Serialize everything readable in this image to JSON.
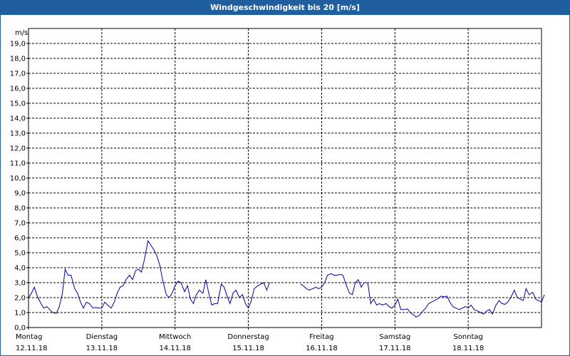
{
  "chart_data": {
    "type": "line",
    "title": "Windgeschwindigkeit bis 20 [m/s]",
    "ylabel": "m/s",
    "ylim": [
      0,
      20
    ],
    "yticks": [
      "0,0",
      "1,0",
      "2,0",
      "3,0",
      "4,0",
      "5,0",
      "6,0",
      "7,0",
      "8,0",
      "9,0",
      "10,0",
      "11,0",
      "12,0",
      "13,0",
      "14,0",
      "15,0",
      "16,0",
      "17,0",
      "18,0",
      "19,0"
    ],
    "xlim": [
      0,
      7
    ],
    "x_categories": [
      {
        "day": "Montag",
        "date": "12.11.18"
      },
      {
        "day": "Dienstag",
        "date": "13.11.18"
      },
      {
        "day": "Mittwoch",
        "date": "14.11.18"
      },
      {
        "day": "Donnerstag",
        "date": "15.11.18"
      },
      {
        "day": "Freitag",
        "date": "16.11.18"
      },
      {
        "day": "Samstag",
        "date": "17.11.18"
      },
      {
        "day": "Sonntag",
        "date": "18.11.18"
      }
    ],
    "grid": true,
    "series_color": "#0000a0",
    "series": [
      {
        "segments": [
          [
            [
              0.0,
              2.0
            ],
            [
              0.04,
              2.3
            ],
            [
              0.08,
              2.7
            ],
            [
              0.12,
              2.1
            ],
            [
              0.17,
              1.6
            ],
            [
              0.21,
              1.3
            ],
            [
              0.25,
              1.4
            ],
            [
              0.29,
              1.2
            ],
            [
              0.33,
              1.0
            ],
            [
              0.38,
              0.95
            ],
            [
              0.42,
              1.4
            ],
            [
              0.46,
              2.2
            ],
            [
              0.5,
              3.9
            ],
            [
              0.54,
              3.5
            ],
            [
              0.58,
              3.5
            ],
            [
              0.63,
              2.6
            ],
            [
              0.67,
              2.3
            ],
            [
              0.71,
              1.7
            ],
            [
              0.75,
              1.3
            ],
            [
              0.79,
              1.7
            ],
            [
              0.83,
              1.6
            ],
            [
              0.88,
              1.3
            ],
            [
              0.92,
              1.35
            ],
            [
              0.96,
              1.3
            ],
            [
              1.0,
              1.3
            ],
            [
              1.04,
              1.7
            ],
            [
              1.08,
              1.5
            ],
            [
              1.13,
              1.3
            ],
            [
              1.17,
              1.7
            ],
            [
              1.21,
              2.3
            ],
            [
              1.25,
              2.7
            ],
            [
              1.29,
              2.8
            ],
            [
              1.33,
              3.2
            ],
            [
              1.38,
              3.5
            ],
            [
              1.42,
              3.2
            ],
            [
              1.46,
              3.8
            ],
            [
              1.5,
              3.9
            ],
            [
              1.54,
              3.7
            ],
            [
              1.58,
              4.5
            ],
            [
              1.63,
              5.8
            ],
            [
              1.67,
              5.5
            ],
            [
              1.71,
              5.2
            ],
            [
              1.75,
              4.8
            ],
            [
              1.79,
              4.2
            ],
            [
              1.83,
              3.2
            ],
            [
              1.88,
              2.2
            ],
            [
              1.92,
              2.0
            ],
            [
              1.96,
              2.3
            ],
            [
              2.0,
              2.8
            ],
            [
              2.04,
              3.1
            ],
            [
              2.08,
              3.0
            ],
            [
              2.13,
              2.4
            ],
            [
              2.17,
              2.8
            ],
            [
              2.21,
              1.9
            ],
            [
              2.25,
              1.6
            ],
            [
              2.29,
              2.2
            ],
            [
              2.33,
              2.5
            ],
            [
              2.38,
              2.3
            ],
            [
              2.42,
              3.2
            ],
            [
              2.46,
              2.3
            ],
            [
              2.5,
              1.5
            ],
            [
              2.54,
              1.6
            ],
            [
              2.58,
              1.6
            ],
            [
              2.63,
              2.9
            ],
            [
              2.67,
              2.7
            ],
            [
              2.71,
              2.1
            ],
            [
              2.75,
              1.6
            ],
            [
              2.79,
              2.3
            ],
            [
              2.83,
              2.5
            ],
            [
              2.88,
              2.0
            ],
            [
              2.92,
              2.2
            ],
            [
              2.96,
              1.6
            ],
            [
              3.0,
              1.3
            ],
            [
              3.04,
              1.8
            ],
            [
              3.08,
              2.6
            ],
            [
              3.13,
              2.8
            ],
            [
              3.17,
              2.9
            ],
            [
              3.21,
              3.0
            ],
            [
              3.25,
              2.5
            ],
            [
              3.29,
              3.0
            ]
          ],
          [
            [
              3.71,
              2.9
            ],
            [
              3.75,
              2.8
            ],
            [
              3.79,
              2.6
            ],
            [
              3.83,
              2.5
            ],
            [
              3.88,
              2.6
            ],
            [
              3.92,
              2.7
            ],
            [
              3.96,
              2.6
            ],
            [
              4.0,
              2.7
            ],
            [
              4.04,
              3.0
            ],
            [
              4.08,
              3.5
            ],
            [
              4.13,
              3.6
            ],
            [
              4.17,
              3.5
            ],
            [
              4.21,
              3.5
            ],
            [
              4.25,
              3.55
            ],
            [
              4.29,
              3.5
            ],
            [
              4.33,
              2.9
            ],
            [
              4.38,
              2.3
            ],
            [
              4.42,
              2.2
            ],
            [
              4.46,
              3.0
            ],
            [
              4.5,
              3.2
            ],
            [
              4.54,
              2.7
            ],
            [
              4.58,
              3.0
            ],
            [
              4.63,
              3.0
            ],
            [
              4.67,
              1.6
            ],
            [
              4.71,
              1.9
            ],
            [
              4.75,
              1.5
            ],
            [
              4.79,
              1.6
            ],
            [
              4.83,
              1.5
            ],
            [
              4.88,
              1.6
            ],
            [
              4.92,
              1.4
            ],
            [
              4.96,
              1.3
            ],
            [
              5.0,
              1.5
            ],
            [
              5.04,
              1.9
            ],
            [
              5.08,
              1.2
            ],
            [
              5.13,
              1.2
            ],
            [
              5.17,
              1.25
            ],
            [
              5.21,
              1.0
            ],
            [
              5.25,
              0.85
            ],
            [
              5.29,
              0.7
            ],
            [
              5.33,
              0.8
            ],
            [
              5.38,
              1.1
            ],
            [
              5.42,
              1.3
            ],
            [
              5.46,
              1.6
            ],
            [
              5.5,
              1.7
            ],
            [
              5.54,
              1.8
            ],
            [
              5.58,
              1.9
            ],
            [
              5.63,
              2.1
            ],
            [
              5.67,
              2.05
            ],
            [
              5.71,
              2.1
            ],
            [
              5.75,
              1.7
            ],
            [
              5.79,
              1.4
            ],
            [
              5.83,
              1.3
            ],
            [
              5.88,
              1.2
            ],
            [
              5.92,
              1.3
            ],
            [
              5.96,
              1.4
            ],
            [
              6.0,
              1.3
            ],
            [
              6.04,
              1.5
            ],
            [
              6.08,
              1.2
            ],
            [
              6.13,
              1.1
            ],
            [
              6.17,
              1.0
            ],
            [
              6.21,
              0.9
            ],
            [
              6.25,
              1.1
            ],
            [
              6.29,
              1.2
            ],
            [
              6.33,
              0.9
            ],
            [
              6.38,
              1.5
            ],
            [
              6.42,
              1.8
            ],
            [
              6.46,
              1.6
            ],
            [
              6.5,
              1.55
            ],
            [
              6.54,
              1.7
            ],
            [
              6.58,
              2.0
            ],
            [
              6.63,
              2.5
            ],
            [
              6.67,
              2.0
            ],
            [
              6.71,
              1.9
            ],
            [
              6.75,
              1.8
            ],
            [
              6.79,
              2.6
            ],
            [
              6.83,
              2.2
            ],
            [
              6.88,
              2.35
            ],
            [
              6.92,
              1.9
            ],
            [
              6.96,
              1.8
            ],
            [
              7.0,
              1.7
            ],
            [
              7.04,
              2.2
            ]
          ]
        ]
      }
    ]
  }
}
